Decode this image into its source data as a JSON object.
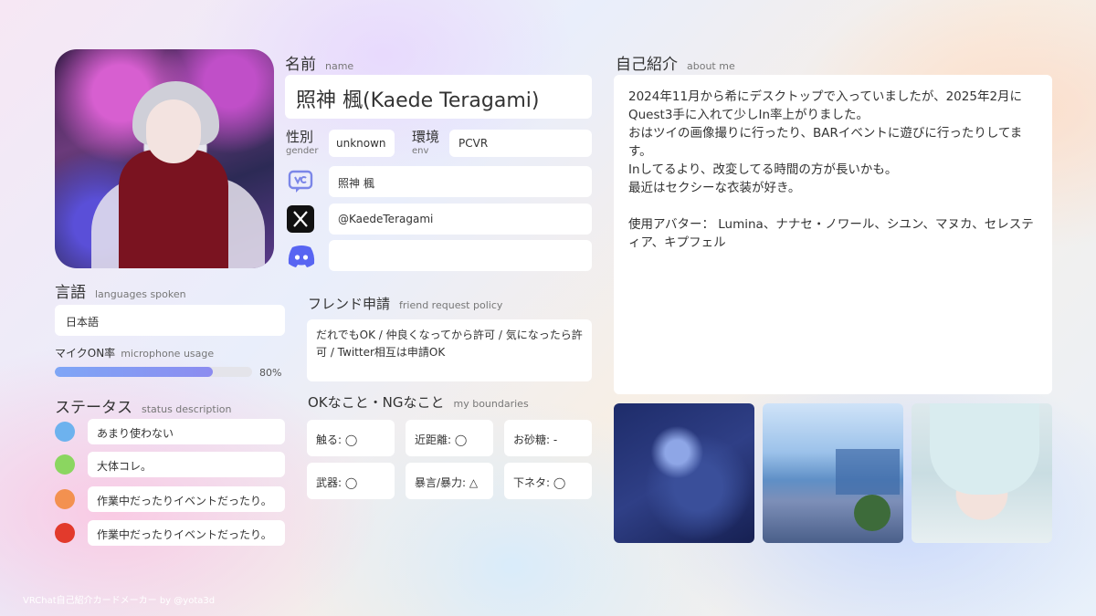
{
  "languages": {
    "title": "言語",
    "subtitle": "languages spoken",
    "value": "日本語",
    "mic_label": "マイクON率",
    "mic_subtitle": "microphone usage",
    "mic_percent": 80,
    "mic_value_text": "80%"
  },
  "status": {
    "title": "ステータス",
    "subtitle": "status description",
    "items": [
      {
        "color": "#6db2ee",
        "text": "あまり使わない"
      },
      {
        "color": "#8bd660",
        "text": "大体コレ。"
      },
      {
        "color": "#f39150",
        "text": "作業中だったりイベントだったり。"
      },
      {
        "color": "#e23a2c",
        "text": "作業中だったりイベントだったり。"
      }
    ]
  },
  "profile": {
    "name_title": "名前",
    "name_subtitle": "name",
    "name": "照神 楓(Kaede Teragami)",
    "gender_label": "性別",
    "gender_sub": "gender",
    "gender": "unknown",
    "env_label": "環境",
    "env_sub": "env",
    "env": "PCVR"
  },
  "social": {
    "vrchat": "照神 楓",
    "x": "@KaedeTeragami",
    "discord": ""
  },
  "friend": {
    "title": "フレンド申請",
    "subtitle": "friend request policy",
    "text": "だれでもOK / 仲良くなってから許可 / 気になったら許可 / Twitter相互は申請OK"
  },
  "boundaries": {
    "title": "OKなこと・NGなこと",
    "subtitle": "my boundaries",
    "items": [
      "触る: ◯",
      "近距離: ◯",
      "お砂糖: -",
      "武器: ◯",
      "暴言/暴力: △",
      "下ネタ: ◯"
    ]
  },
  "about": {
    "title": "自己紹介",
    "subtitle": "about me",
    "lines": [
      "2024年11月から希にデスクトップで入っていましたが、2025年2月にQuest3手に入れて少しIn率上がりました。",
      "おはツイの画像撮りに行ったり、BARイベントに遊びに行ったりしてます。",
      "Inしてるより、改変してる時間の方が長いかも。",
      "最近はセクシーな衣装が好き。",
      "",
      "使用アバター： Lumina、ナナセ・ノワール、シユン、マヌカ、セレスティア、キプフェル"
    ]
  },
  "footer": "VRChat自己紹介カードメーカー by @yota3d"
}
